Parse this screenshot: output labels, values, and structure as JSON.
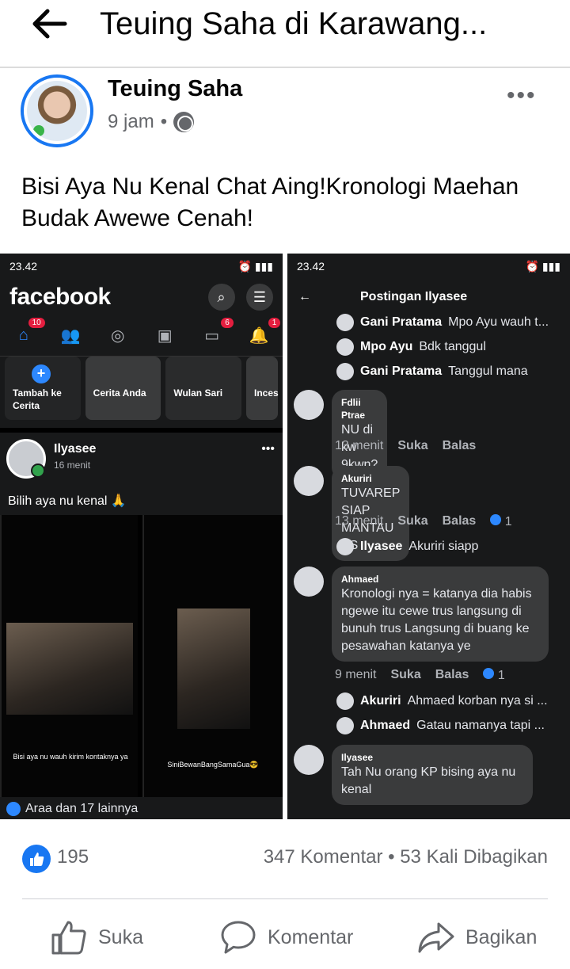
{
  "header": {
    "title": "Teuing Saha di Karawang..."
  },
  "post": {
    "author": "Teuing Saha",
    "time": "9 jam",
    "separator": "•",
    "more": "•••",
    "caption": "Bisi Aya Nu Kenal Chat Aing!Kronologi Maehan Budak Awewe Cenah!"
  },
  "screenshot_left": {
    "status_time": "23.42",
    "app_name": "facebook",
    "badges": {
      "home": "10",
      "video": "6",
      "notifications": "1"
    },
    "stories": [
      "Tambah ke Cerita",
      "Cerita Anda",
      "Wulan Sari",
      "Inces"
    ],
    "post_author": "Ilyasee",
    "post_time": "16 menit",
    "post_text": "Bilih aya nu kenal 🙏",
    "media_caption_left": "Bisi aya nu wauh kirim kontaknya ya",
    "media_caption_right": "SiniBewanBangSamaGua😎",
    "reactions": "Araa dan 17 lainnya"
  },
  "screenshot_right": {
    "status_time": "23.42",
    "title": "Postingan Ilyasee",
    "replies_top": [
      {
        "name": "Gani Pratama",
        "text": "Mpo Ayu wauh t..."
      },
      {
        "name": "Mpo Ayu",
        "text": "Bdk tanggul"
      },
      {
        "name": "Gani Pratama",
        "text": "Tanggul mana"
      }
    ],
    "comments": [
      {
        "name": "Fdlii Ptrae",
        "text": "NU di kw 9kwn?",
        "time": "13 menit",
        "like": "Suka",
        "reply": "Balas",
        "count": ""
      },
      {
        "name": "Akuriri",
        "text": "TUVAREP SIAP MANTAU ES",
        "time": "13 menit",
        "like": "Suka",
        "reply": "Balas",
        "count": "1"
      },
      {
        "name": "Ahmaed",
        "text": "Kronologi nya = katanya dia habis ngewe itu cewe trus langsung di bunuh trus Langsung di buang ke pesawahan katanya ye",
        "time": "9 menit",
        "like": "Suka",
        "reply": "Balas",
        "count": "1"
      },
      {
        "name": "Ilyasee",
        "text": "Tah Nu orang KP bising aya nu kenal",
        "time": "",
        "like": "",
        "reply": "",
        "count": ""
      }
    ],
    "reply_ilyasee": {
      "name": "Ilyasee",
      "text": "Akuriri siapp"
    },
    "reply_akuriri": {
      "name": "Akuriri",
      "text": "Ahmaed korban nya si ..."
    },
    "reply_ahmaed": {
      "name": "Ahmaed",
      "text": "Gatau namanya tapi ..."
    }
  },
  "stats": {
    "likes": "195",
    "comments_shares": "347 Komentar • 53 Kali Dibagikan"
  },
  "actions": {
    "like": "Suka",
    "comment": "Komentar",
    "share": "Bagikan"
  },
  "colors": {
    "accent": "#1877f2",
    "text_secondary": "#65676b",
    "dark_bg": "#18191a"
  }
}
